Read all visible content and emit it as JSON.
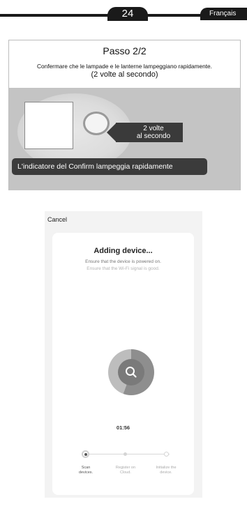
{
  "header": {
    "page_number": "24",
    "language": "Français"
  },
  "step_card": {
    "title": "Passo 2/2",
    "instruction": "Confermare che le lampade e le lanterne lampeggiano rapidamente.",
    "frequency": "(2 volte al secondo)",
    "callout_line1": "2 volte",
    "callout_line2": "al secondo",
    "banner": "L'indicatore del Confirm lampeggia rapidamente"
  },
  "phone": {
    "cancel_label": "Cancel",
    "title": "Adding device...",
    "subtitle_1": "Ensure that the device is powered on.",
    "subtitle_2": "Ensure that the Wi-Fi signal is good.",
    "timer": "01:56",
    "steps": [
      {
        "line1": "Scan",
        "line2": "devices."
      },
      {
        "line1": "Register on",
        "line2": "Cloud."
      },
      {
        "line1": "Initialize the",
        "line2": "device."
      }
    ]
  }
}
